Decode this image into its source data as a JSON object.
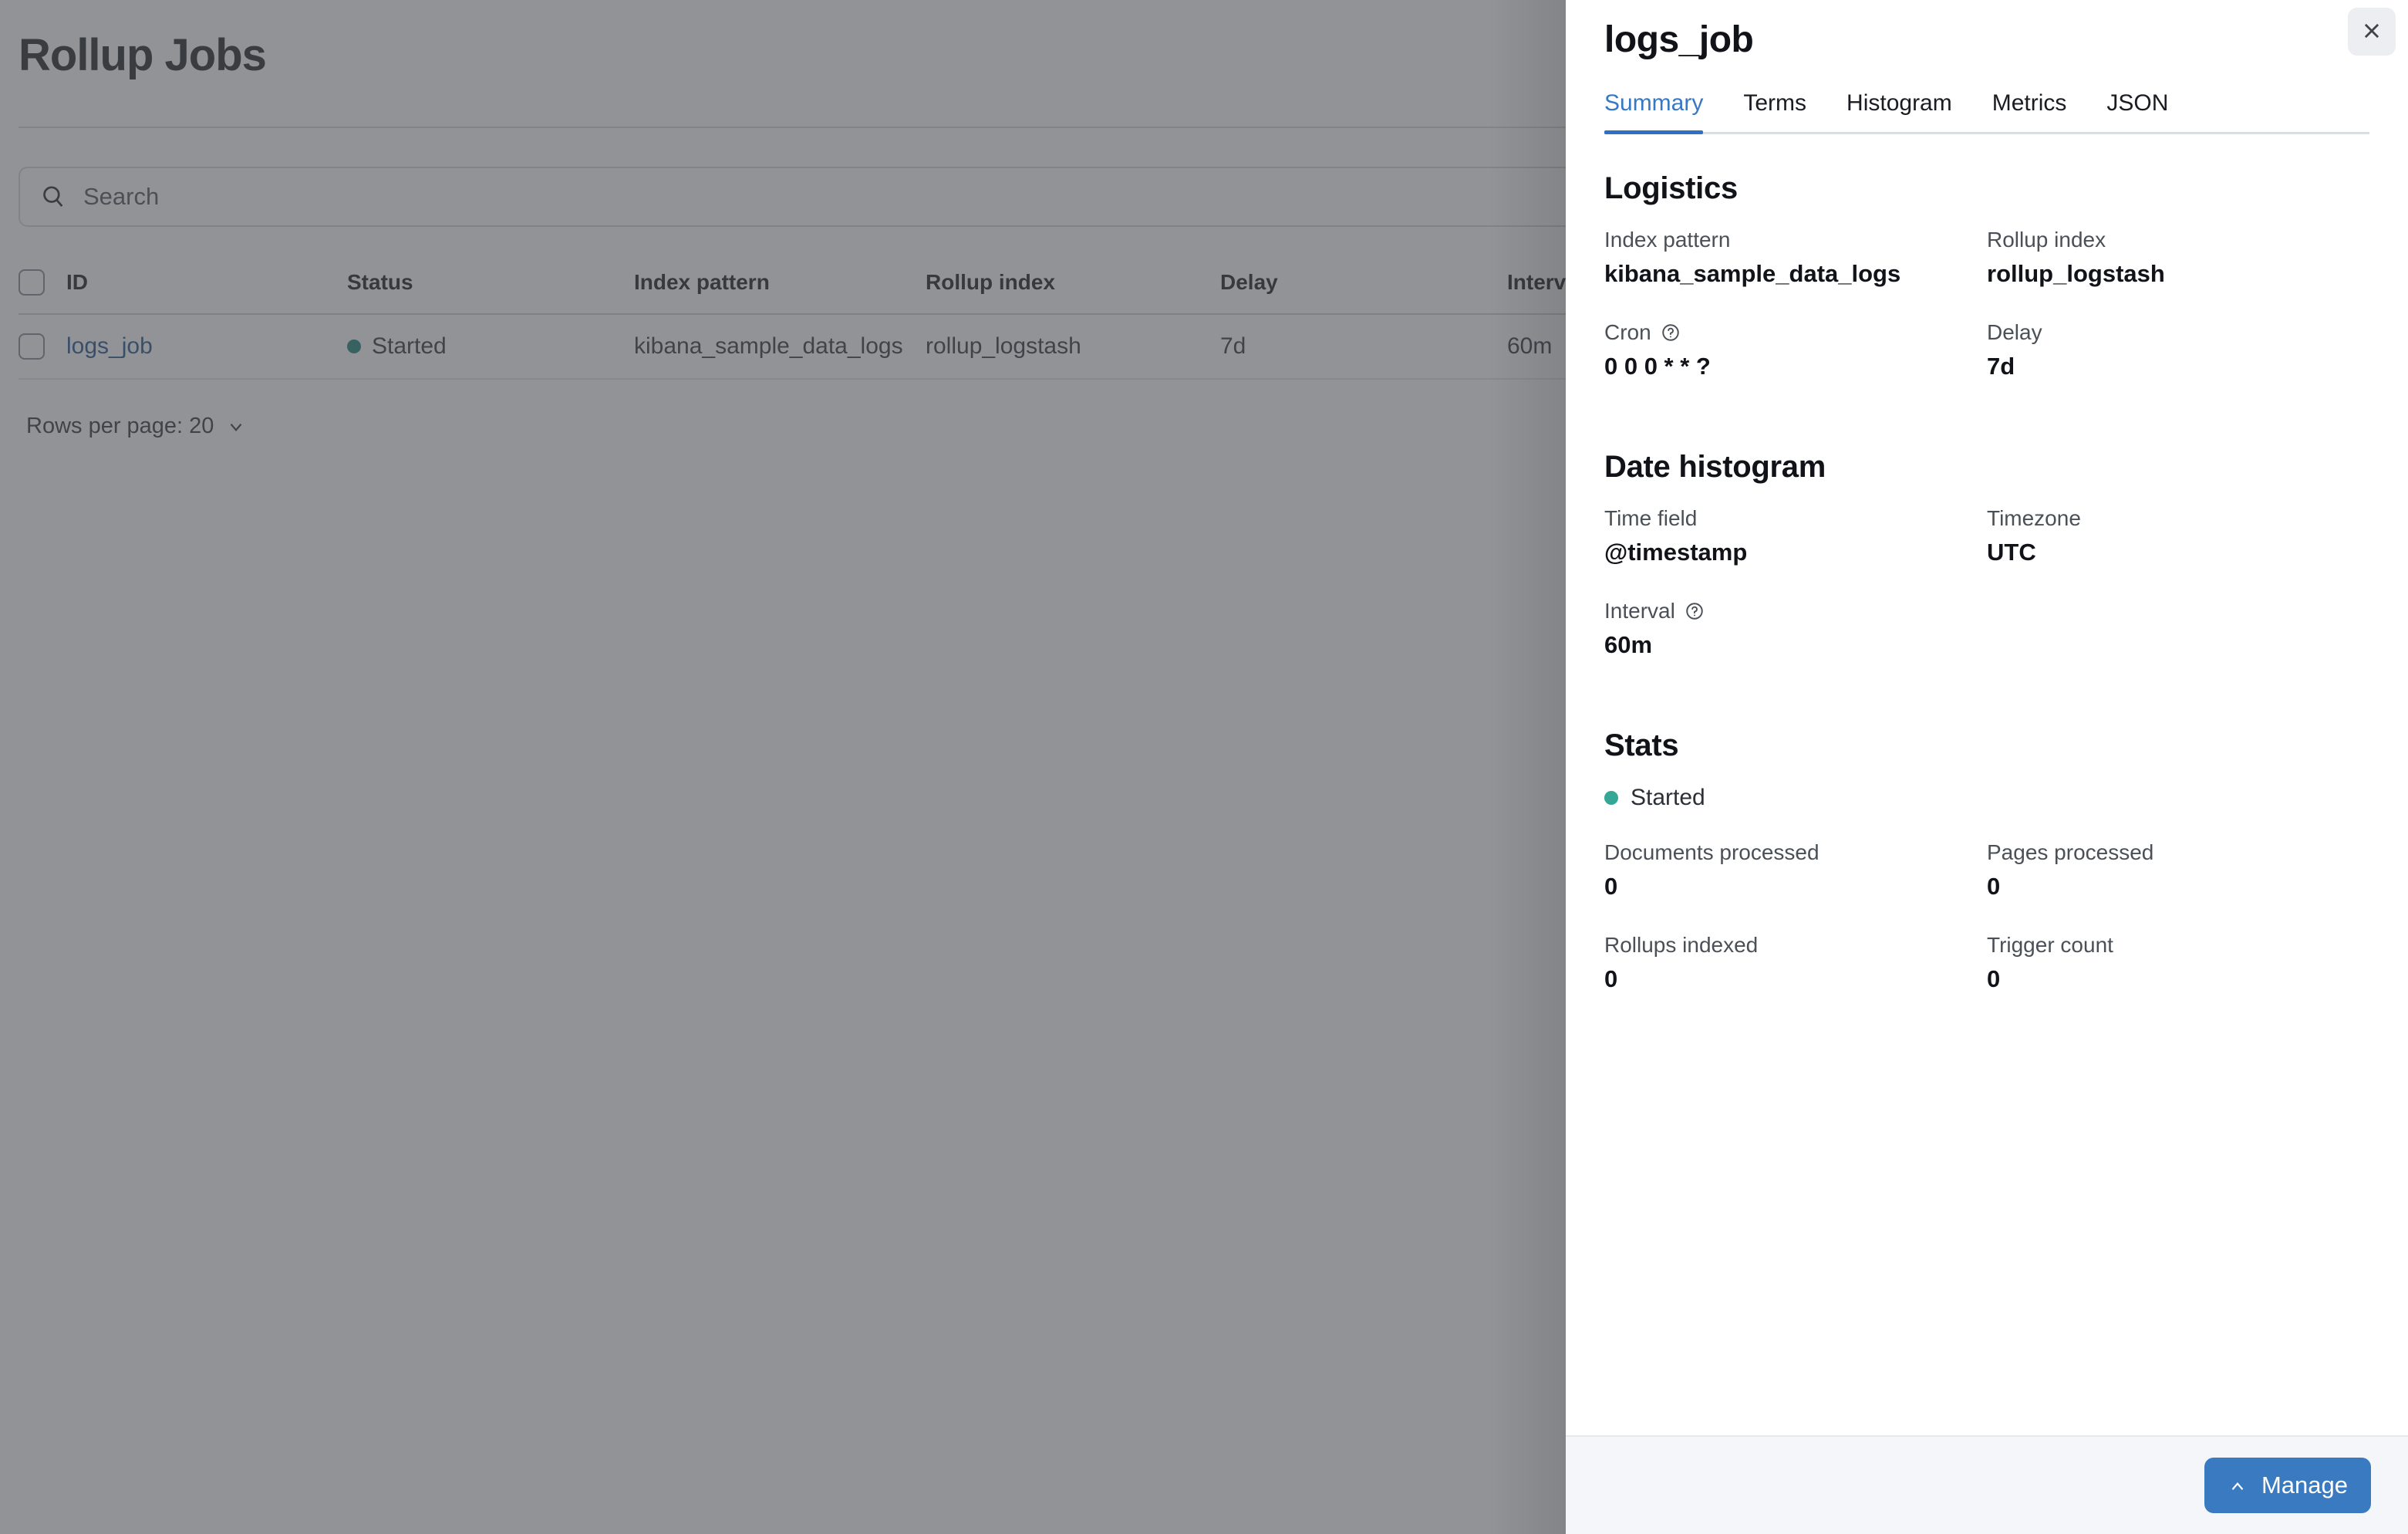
{
  "page": {
    "title": "Rollup Jobs"
  },
  "search": {
    "placeholder": "Search",
    "value": "",
    "icon": "search-icon"
  },
  "table": {
    "columns": [
      "ID",
      "Status",
      "Index pattern",
      "Rollup index",
      "Delay",
      "Interval"
    ],
    "rows": [
      {
        "id": "logs_job",
        "status": "Started",
        "index_pattern": "kibana_sample_data_logs",
        "rollup_index": "rollup_logstash",
        "delay": "7d",
        "interval": "60m"
      }
    ],
    "status_dot_color": "#177f73"
  },
  "pagination": {
    "rows_per_page_label": "Rows per page: 20",
    "chevron_icon": "chevron-down-icon"
  },
  "flyout": {
    "title": "logs_job",
    "close_icon": "close-icon",
    "tabs": [
      {
        "label": "Summary",
        "active": true
      },
      {
        "label": "Terms",
        "active": false
      },
      {
        "label": "Histogram",
        "active": false
      },
      {
        "label": "Metrics",
        "active": false
      },
      {
        "label": "JSON",
        "active": false
      }
    ],
    "accent_color": "#2f6fc4",
    "sections": {
      "logistics": {
        "title": "Logistics",
        "fields": [
          {
            "label": "Index pattern",
            "value": "kibana_sample_data_logs",
            "help": false
          },
          {
            "label": "Rollup index",
            "value": "rollup_logstash",
            "help": false
          },
          {
            "label": "Cron",
            "value": "0 0 0 * * ?",
            "help": true
          },
          {
            "label": "Delay",
            "value": "7d",
            "help": false
          }
        ]
      },
      "date_histogram": {
        "title": "Date histogram",
        "fields": [
          {
            "label": "Time field",
            "value": "@timestamp",
            "help": false
          },
          {
            "label": "Timezone",
            "value": "UTC",
            "help": false
          },
          {
            "label": "Interval",
            "value": "60m",
            "help": true
          }
        ]
      },
      "stats": {
        "title": "Stats",
        "status": "Started",
        "status_dot_color": "#36a697",
        "fields": [
          {
            "label": "Documents processed",
            "value": "0",
            "help": false
          },
          {
            "label": "Pages processed",
            "value": "0",
            "help": false
          },
          {
            "label": "Rollups indexed",
            "value": "0",
            "help": false
          },
          {
            "label": "Trigger count",
            "value": "0",
            "help": false
          }
        ]
      }
    },
    "footer": {
      "manage_label": "Manage",
      "manage_icon": "chevron-up-icon",
      "manage_color": "#3a7ac0"
    }
  }
}
